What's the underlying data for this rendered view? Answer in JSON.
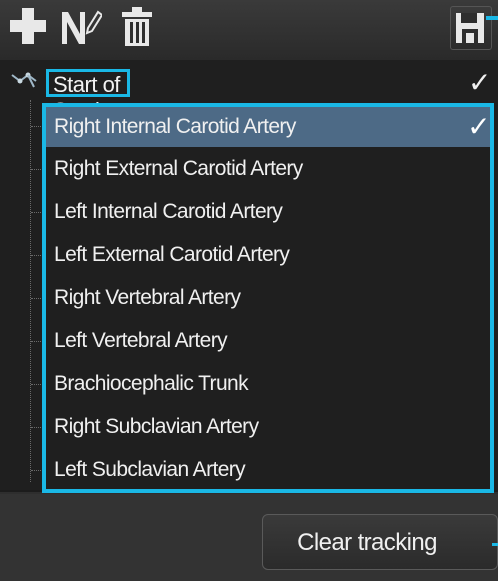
{
  "toolbar": {
    "add_icon": "plus-icon",
    "note_icon": "note-edit-icon",
    "delete_icon": "trash-icon",
    "save_icon": "save-icon"
  },
  "tree": {
    "root": {
      "label": "Start of Section",
      "checked": true
    },
    "items": [
      {
        "label": "Right Internal Carotid Artery",
        "selected": true,
        "checked": true
      },
      {
        "label": "Right External Carotid Artery"
      },
      {
        "label": "Left Internal Carotid Artery"
      },
      {
        "label": "Left External Carotid Artery"
      },
      {
        "label": "Right Vertebral Artery"
      },
      {
        "label": "Left Vertebral Artery"
      },
      {
        "label": "Brachiocephalic Trunk"
      },
      {
        "label": "Right Subclavian Artery"
      },
      {
        "label": "Left Subclavian Artery"
      }
    ]
  },
  "footer": {
    "clear_label": "Clear tracking"
  },
  "colors": {
    "annotation": "#1ab8e6",
    "selection": "#4d6a86",
    "background": "#1f1f1f"
  }
}
